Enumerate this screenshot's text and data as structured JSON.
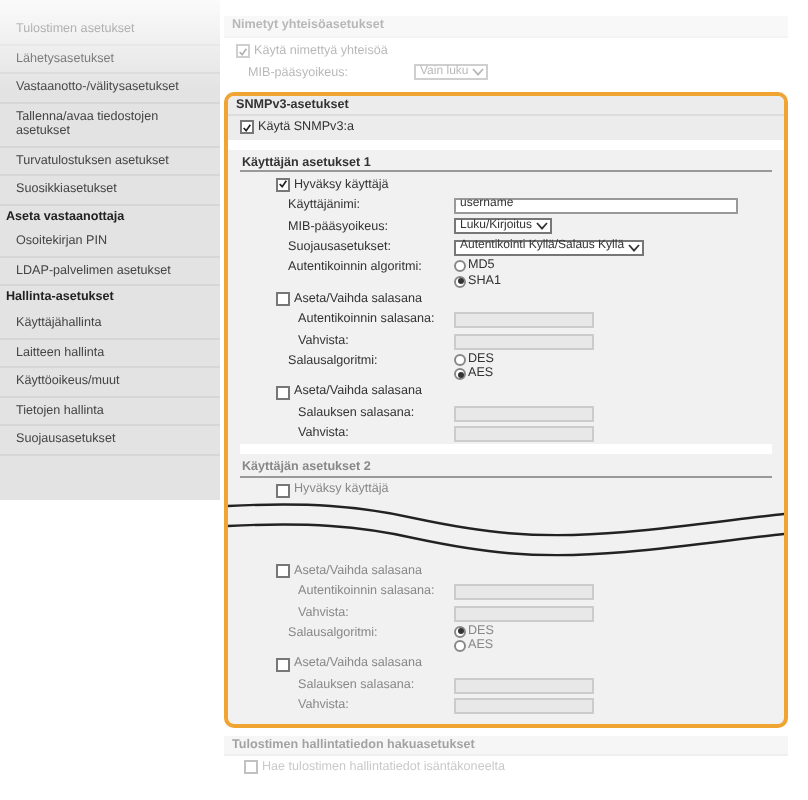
{
  "sidebar": {
    "items": [
      {
        "label": "Tulostimen asetukset",
        "kind": "item"
      },
      {
        "label": "Lähetysasetukset",
        "kind": "item"
      },
      {
        "label": "Vastaanotto-/välitysasetukset",
        "kind": "item"
      },
      {
        "label": "Tallenna/avaa tiedostojen asetukset",
        "kind": "item"
      },
      {
        "label": "Turvatulostuksen asetukset",
        "kind": "item"
      },
      {
        "label": "Suosikkiasetukset",
        "kind": "item"
      },
      {
        "label": "Aseta vastaanottaja",
        "kind": "header"
      },
      {
        "label": "Osoitekirjan PIN",
        "kind": "item"
      },
      {
        "label": "LDAP-palvelimen asetukset",
        "kind": "item"
      },
      {
        "label": "Hallinta-asetukset",
        "kind": "header"
      },
      {
        "label": "Käyttäjähallinta",
        "kind": "item"
      },
      {
        "label": "Laitteen hallinta",
        "kind": "item"
      },
      {
        "label": "Käyttöoikeus/muut",
        "kind": "item"
      },
      {
        "label": "Tietojen hallinta",
        "kind": "item"
      },
      {
        "label": "Suojausasetukset",
        "kind": "item"
      }
    ]
  },
  "community_settings": {
    "header": "Nimetyt yhteisöasetukset",
    "rows": [
      {
        "kind": "checkbox",
        "label": "Käytä nimettyä yhteisöä",
        "checked": true
      },
      {
        "kind": "select",
        "label": "MIB-pääsyoikeus:",
        "value": "Vain luku"
      }
    ]
  },
  "snmpv3": {
    "header": "SNMPv3-asetukset",
    "enable": {
      "label": "Käytä SNMPv3:a",
      "checked": true
    },
    "users": [
      {
        "header": "Käyttäjän asetukset 1",
        "disabled": false,
        "rows": [
          {
            "kind": "checkbox",
            "label": "Hyväksy käyttäjä",
            "checked": true
          },
          {
            "kind": "text",
            "label": "Käyttäjänimi:",
            "value": "username"
          },
          {
            "kind": "select",
            "label": "MIB-pääsyoikeus:",
            "value": "Luku/Kirjoitus"
          },
          {
            "kind": "select",
            "label": "Suojausasetukset:",
            "value": "Autentikointi Kyllä/Salaus Kyllä"
          },
          {
            "kind": "radio",
            "label": "Autentikoinnin algoritmi:",
            "options": [
              {
                "label": "MD5",
                "selected": false
              },
              {
                "label": "SHA1",
                "selected": true
              }
            ]
          },
          {
            "kind": "checkbox",
            "label": "Aseta/Vaihda salasana",
            "checked": false
          },
          {
            "kind": "password",
            "label": "Autentikoinnin salasana:"
          },
          {
            "kind": "password",
            "label": "Vahvista:"
          },
          {
            "kind": "radio",
            "label": "Salausalgoritmi:",
            "options": [
              {
                "label": "DES",
                "selected": false
              },
              {
                "label": "AES",
                "selected": true
              }
            ]
          },
          {
            "kind": "checkbox",
            "label": "Aseta/Vaihda salasana",
            "checked": false
          },
          {
            "kind": "password",
            "label": "Salauksen salasana:"
          },
          {
            "kind": "password",
            "label": "Vahvista:"
          }
        ]
      },
      {
        "header": "Käyttäjän asetukset 2",
        "disabled": true,
        "rows": [
          {
            "kind": "checkbox",
            "label": "Hyväksy käyttäjä",
            "checked": false
          },
          {
            "kind": "cut"
          },
          {
            "kind": "checkbox",
            "label": "Aseta/Vaihda salasana",
            "checked": false
          },
          {
            "kind": "password",
            "label": "Autentikoinnin salasana:"
          },
          {
            "kind": "password",
            "label": "Vahvista:"
          },
          {
            "kind": "radio",
            "label": "Salausalgoritmi:",
            "options": [
              {
                "label": "DES",
                "selected": true
              },
              {
                "label": "AES",
                "selected": false
              }
            ]
          },
          {
            "kind": "checkbox",
            "label": "Aseta/Vaihda salasana",
            "checked": false
          },
          {
            "kind": "password",
            "label": "Salauksen salasana:"
          },
          {
            "kind": "password",
            "label": "Vahvista:"
          }
        ]
      }
    ]
  },
  "printer_info": {
    "header": "Tulostimen hallintatiedon hakuasetukset",
    "rows": [
      {
        "kind": "checkbox",
        "label": "Hae tulostimen hallintatiedot isäntäkoneelta",
        "checked": false
      }
    ]
  }
}
